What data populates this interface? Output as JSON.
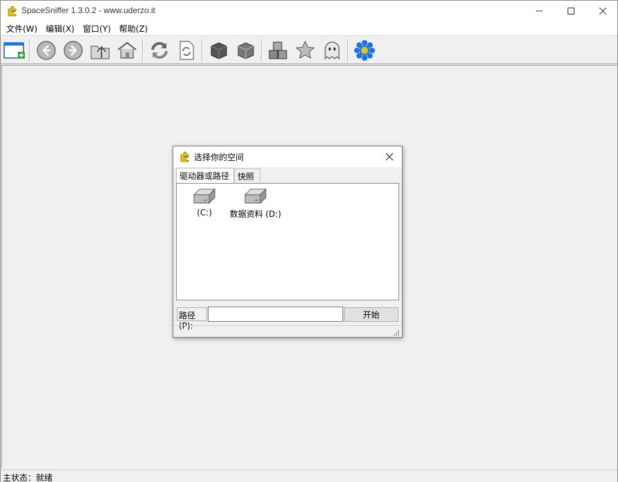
{
  "window": {
    "title": "SpaceSniffer 1.3.0.2 - www.uderzo.it"
  },
  "menu": [
    {
      "label": "文件(W)"
    },
    {
      "label": "编辑(X)"
    },
    {
      "label": "窗口(Y)"
    },
    {
      "label": "帮助(Z)"
    }
  ],
  "toolbar": {
    "icons": [
      "new-window-icon",
      "back-icon",
      "forward-icon",
      "up-folder-icon",
      "home-icon",
      "refresh-icon",
      "refresh-document-icon",
      "dark-cube-icon",
      "cube-icon",
      "cubes-icon",
      "star-icon",
      "ghost-icon",
      "flower-icon"
    ]
  },
  "status": {
    "text": "主状态：就绪"
  },
  "dialog": {
    "title": "选择你的空间",
    "tabs": [
      {
        "label": "驱动器或路径"
      },
      {
        "label": "快照"
      }
    ],
    "drives": [
      {
        "label": "(C:)"
      },
      {
        "label": "数据资料 (D:)"
      }
    ],
    "path_label": "路径(P):",
    "path_value": "",
    "start_label": "开始"
  },
  "colors": {
    "accent_blue": "#1a73e8",
    "plus_green": "#2fa52f",
    "icon_yellow": "#f2c200"
  }
}
